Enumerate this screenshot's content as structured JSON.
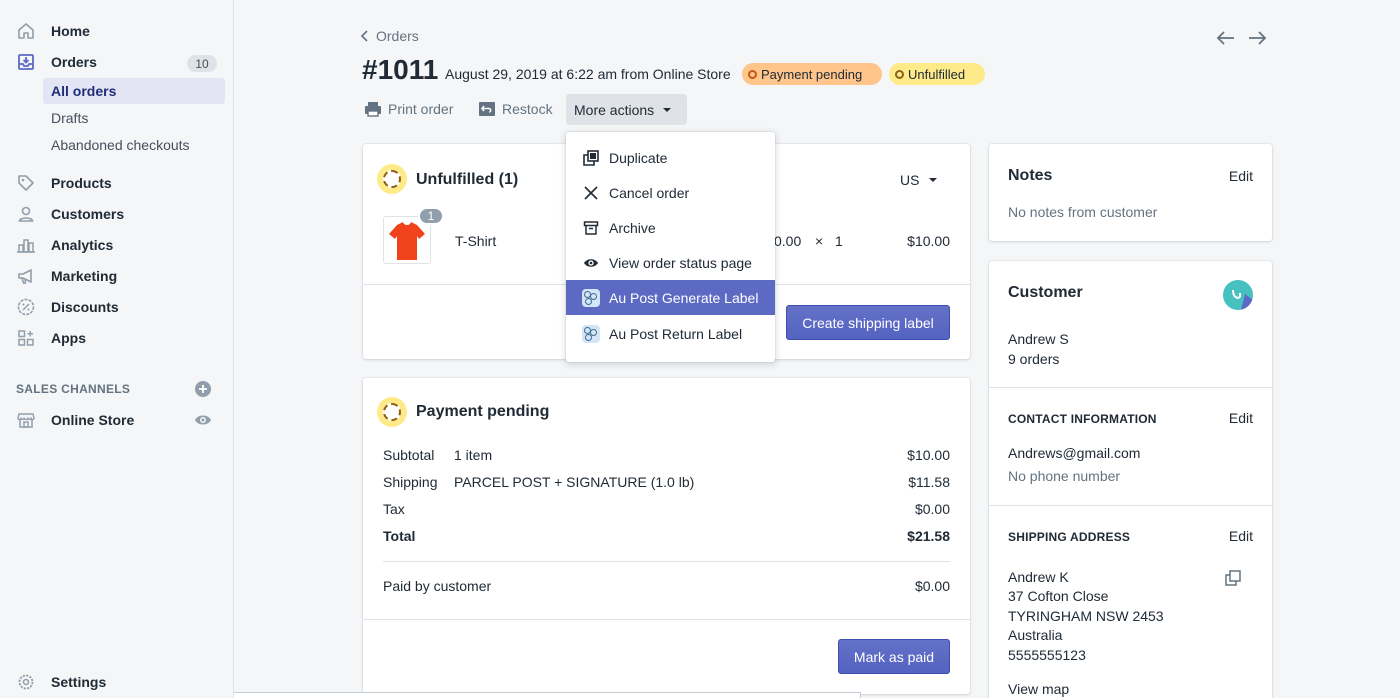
{
  "sidebar": {
    "home": "Home",
    "orders": "Orders",
    "orders_count": "10",
    "all_orders": "All orders",
    "drafts": "Drafts",
    "abandoned": "Abandoned checkouts",
    "products": "Products",
    "customers": "Customers",
    "analytics": "Analytics",
    "marketing": "Marketing",
    "discounts": "Discounts",
    "apps": "Apps",
    "sales_channels": "SALES CHANNELS",
    "online_store": "Online Store",
    "settings": "Settings"
  },
  "header": {
    "back": "Orders",
    "order_number": "#1011",
    "meta": "August 29, 2019 at 6:22 am from Online Store",
    "payment_status": "Payment pending",
    "fulfillment_status": "Unfulfilled",
    "print": "Print order",
    "restock": "Restock",
    "more_actions": "More actions"
  },
  "dropdown": {
    "items": [
      {
        "label": "Duplicate",
        "icon": "duplicate-icon"
      },
      {
        "label": "Cancel order",
        "icon": "close-icon"
      },
      {
        "label": "Archive",
        "icon": "archive-icon"
      },
      {
        "label": "View order status page",
        "icon": "eye-icon"
      },
      {
        "label": "Au Post Generate Label",
        "icon": "app-icon"
      },
      {
        "label": "Au Post Return Label",
        "icon": "app-icon"
      }
    ]
  },
  "unfulfilled": {
    "title": "Unfulfilled (1)",
    "location": "US",
    "item_name": "T-Shirt",
    "qty_badge": "1",
    "price_partial": "0.00",
    "times": "×",
    "qty": "1",
    "line_total": "$10.00",
    "shipping_button": "Create shipping label"
  },
  "payment": {
    "title": "Payment pending",
    "subtotal_label": "Subtotal",
    "subtotal_desc": "1 item",
    "subtotal_value": "$10.00",
    "shipping_label": "Shipping",
    "shipping_desc": "PARCEL POST + SIGNATURE (1.0 lb)",
    "shipping_value": "$11.58",
    "tax_label": "Tax",
    "tax_value": "$0.00",
    "total_label": "Total",
    "total_value": "$21.58",
    "paid_label": "Paid by customer",
    "paid_value": "$0.00",
    "mark_paid": "Mark as paid"
  },
  "notes": {
    "title": "Notes",
    "edit": "Edit",
    "empty": "No notes from customer"
  },
  "customer": {
    "title": "Customer",
    "name": "Andrew S",
    "orders": "9 orders",
    "contact_head": "CONTACT INFORMATION",
    "contact_edit": "Edit",
    "email": "Andrews@gmail.com",
    "phone": "No phone number",
    "shipping_head": "SHIPPING ADDRESS",
    "shipping_edit": "Edit",
    "addr_name": "Andrew K",
    "addr_line1": "37 Cofton Close",
    "addr_line2": "TYRINGHAM NSW 2453",
    "addr_country": "Australia",
    "addr_phone": "5555555123",
    "view_map": "View map"
  },
  "colors": {
    "accent": "#5c6ac4",
    "link": "#007ace",
    "payment_pill": "#ffc58b",
    "unfulfilled_pill": "#ffea8a"
  }
}
